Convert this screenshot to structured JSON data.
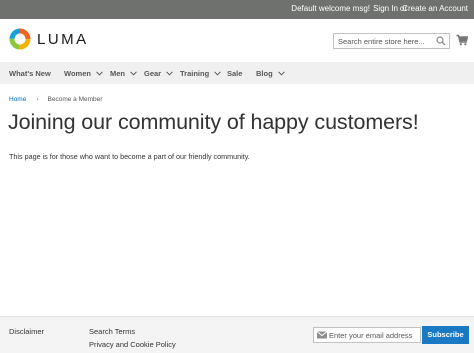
{
  "topbar": {
    "welcome": "Default welcome msg!",
    "sign_in": "Sign In",
    "or": "or",
    "create_account": "Create an Account"
  },
  "header": {
    "logo_text": "LUMA",
    "logo_icon": "luma-logo-icon",
    "search_placeholder": "Search entire store here...",
    "search_icon": "search-icon",
    "cart_icon": "cart-icon"
  },
  "nav": {
    "items": [
      {
        "label": "What's New",
        "has_dropdown": false
      },
      {
        "label": "Women",
        "has_dropdown": true
      },
      {
        "label": "Men",
        "has_dropdown": true
      },
      {
        "label": "Gear",
        "has_dropdown": true
      },
      {
        "label": "Training",
        "has_dropdown": true
      },
      {
        "label": "Sale",
        "has_dropdown": false
      },
      {
        "label": "Blog",
        "has_dropdown": true
      }
    ]
  },
  "breadcrumb": {
    "home": "Home",
    "separator": "›",
    "current": "Become a Member"
  },
  "main": {
    "title": "Joining our community of happy customers!",
    "text": "This page is for those who want to become a part of our friendly community."
  },
  "footer": {
    "links": [
      "Disclaimer",
      "Search Terms",
      "Privacy and Cookie Policy"
    ],
    "newsletter_placeholder": "Enter your email address",
    "subscribe_label": "Subscribe"
  },
  "colors": {
    "topbar_bg": "#6e716e",
    "nav_bg": "#f0f0f0",
    "link": "#006bb4",
    "subscribe_bg": "#1979c3",
    "footer_bg": "#f4f4f4"
  }
}
